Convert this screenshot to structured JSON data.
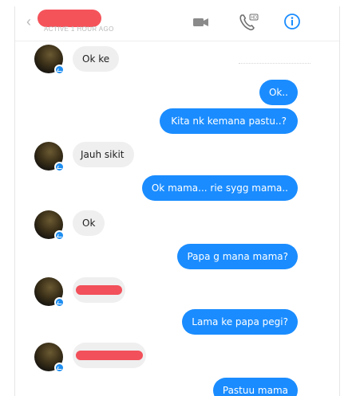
{
  "header": {
    "status": "ACTIVE 1 HOUR AGO",
    "back_icon": "chevron-left-icon",
    "video_icon": "video-camera-icon",
    "phone_icon": "phone-hd-icon",
    "info_icon": "info-icon",
    "accent": "#1a8cff",
    "redact_color": "#f5535a"
  },
  "messages": [
    {
      "side": "in",
      "text": "Ok ke"
    },
    {
      "side": "out",
      "text": "Ok.."
    },
    {
      "side": "out",
      "text": "Kita nk kemana pastu..?"
    },
    {
      "side": "in",
      "text": "Jauh sikit"
    },
    {
      "side": "out",
      "text": "Ok mama... rie sygg mama.."
    },
    {
      "side": "in",
      "text": "Ok"
    },
    {
      "side": "out",
      "text": "Papa g mana mama?"
    },
    {
      "side": "in",
      "text": ""
    },
    {
      "side": "out",
      "text": "Lama ke papa pegi?"
    },
    {
      "side": "in",
      "text": ""
    },
    {
      "side": "out",
      "text": "Pastuu mama"
    }
  ]
}
